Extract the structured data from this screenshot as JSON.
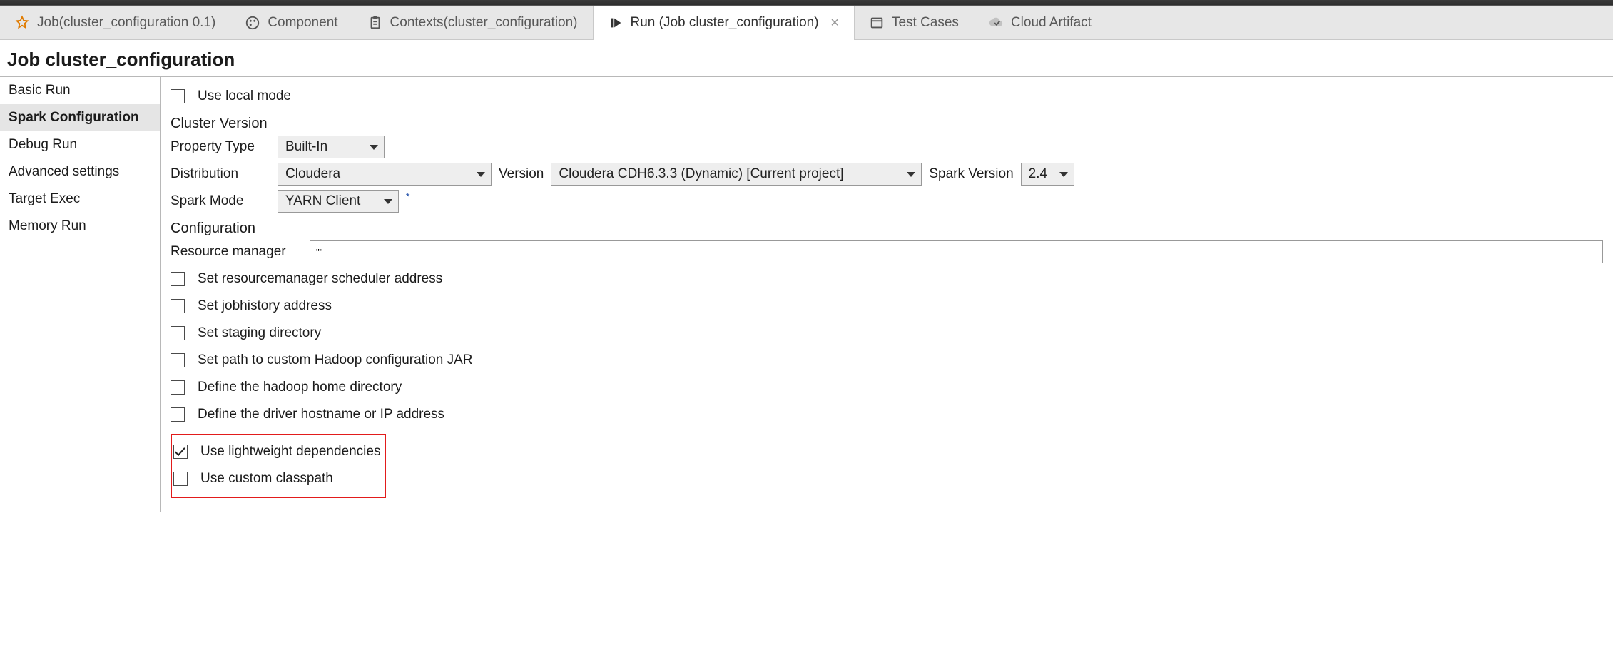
{
  "tabs": {
    "job": {
      "label": "Job(cluster_configuration 0.1)"
    },
    "component": {
      "label": "Component"
    },
    "contexts": {
      "label": "Contexts(cluster_configuration)"
    },
    "run": {
      "label": "Run (Job cluster_configuration)"
    },
    "testcases": {
      "label": "Test Cases"
    },
    "cloud": {
      "label": "Cloud Artifact"
    }
  },
  "page_title": "Job cluster_configuration",
  "sidebar": {
    "items": [
      {
        "label": "Basic Run"
      },
      {
        "label": "Spark Configuration"
      },
      {
        "label": "Debug Run"
      },
      {
        "label": "Advanced settings"
      },
      {
        "label": "Target Exec"
      },
      {
        "label": "Memory Run"
      }
    ],
    "selected_index": 1
  },
  "content": {
    "use_local_mode": {
      "label": "Use local mode",
      "checked": false
    },
    "section_cluster_version": "Cluster Version",
    "property_type": {
      "label": "Property Type",
      "value": "Built-In"
    },
    "distribution": {
      "label": "Distribution",
      "value": "Cloudera"
    },
    "version": {
      "label": "Version",
      "value": "Cloudera CDH6.3.3 (Dynamic) [Current project]"
    },
    "spark_version": {
      "label": "Spark Version",
      "value": "2.4"
    },
    "spark_mode": {
      "label": "Spark Mode",
      "value": "YARN Client"
    },
    "section_configuration": "Configuration",
    "resource_manager": {
      "label": "Resource manager",
      "value": "\"\""
    },
    "checkboxes": [
      {
        "label": "Set resourcemanager scheduler address",
        "checked": false
      },
      {
        "label": "Set jobhistory address",
        "checked": false
      },
      {
        "label": "Set staging directory",
        "checked": false
      },
      {
        "label": "Set path to custom Hadoop configuration JAR",
        "checked": false
      },
      {
        "label": "Define the hadoop home directory",
        "checked": false
      },
      {
        "label": "Define the driver hostname or IP address",
        "checked": false
      }
    ],
    "highlighted": [
      {
        "label": "Use lightweight dependencies",
        "checked": true
      },
      {
        "label": "Use custom classpath",
        "checked": false
      }
    ]
  }
}
